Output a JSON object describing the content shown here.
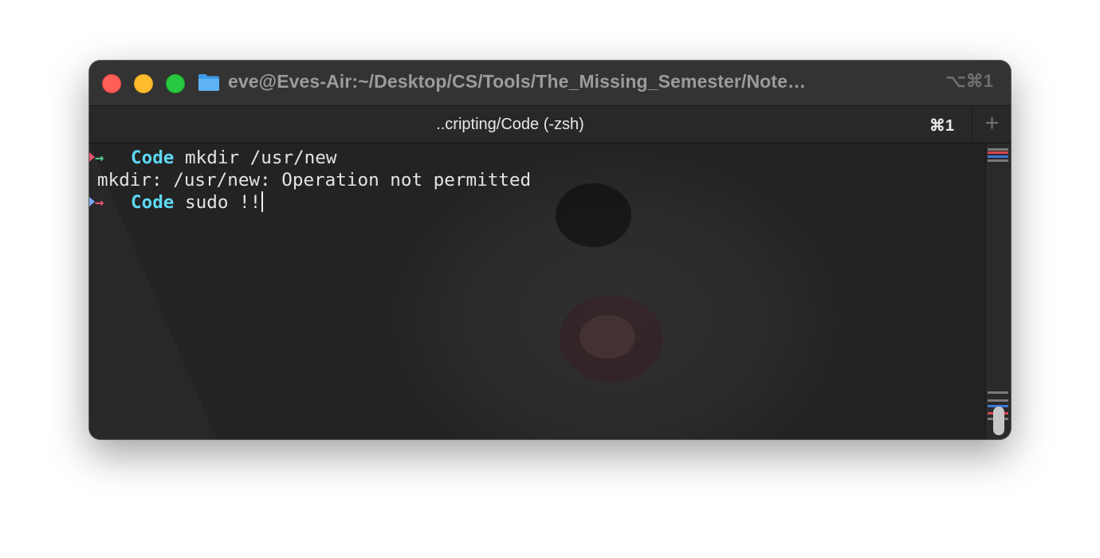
{
  "window": {
    "title": "eve@Eves-Air:~/Desktop/CS/Tools/The_Missing_Semester/Note…",
    "shortcut": "⌥⌘1",
    "folder_icon": "folder-icon"
  },
  "tabs": [
    {
      "title": "..cripting/Code (-zsh)",
      "shortcut": "⌘1",
      "active": true
    }
  ],
  "new_tab": {
    "label": "+"
  },
  "terminal": {
    "lines": [
      {
        "type": "prompt",
        "status": "success",
        "cwd": "Code",
        "command": "mkdir /usr/new"
      },
      {
        "type": "output",
        "text": "mkdir: /usr/new: Operation not permitted"
      },
      {
        "type": "prompt",
        "status": "error",
        "cwd": "Code",
        "command": "sudo !!"
      }
    ],
    "prompt_arrow": "→"
  },
  "colors": {
    "directory": "#5ed8f5",
    "success_arrow": "#56c28a",
    "error_arrow": "#e3526a",
    "text": "#e4e4e4"
  }
}
